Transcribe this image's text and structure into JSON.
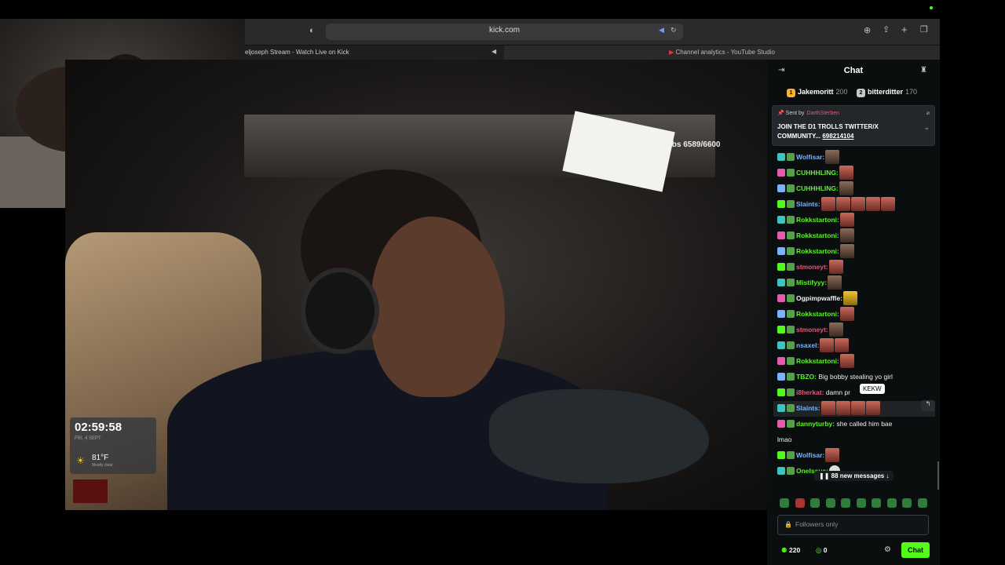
{
  "browser": {
    "url": "kick.com",
    "tab_left": "eljoseph Stream - Watch Live on Kick",
    "tab_right": "Channel analytics - YouTube Studio"
  },
  "video": {
    "subs_goal": "Subs 6589/6600",
    "clock": "02:59:58",
    "clock_sub": "FRI, 4 SEPT",
    "temperature": "81°F",
    "weather_desc": "Mostly clear",
    "icons": [
      "sun-icon"
    ]
  },
  "chat": {
    "title": "Chat",
    "leaderboard": [
      {
        "name": "Jakemoritt",
        "count": "200"
      },
      {
        "name": "bitterditter",
        "count": "170"
      }
    ],
    "pinned": {
      "sent_by": "Sent by",
      "sender": "DarthSterben",
      "text": "JOIN THE D1 TROLLS TWITTER/X COMMUNITY...",
      "link": "698214104"
    },
    "messages": [
      {
        "user": "Wolfisar:",
        "color": "#7bb3ff",
        "text": "",
        "emotes": 1
      },
      {
        "user": "CUHHHLING:",
        "color": "#53fc18",
        "text": "",
        "emotes": 1
      },
      {
        "user": "CUHHHLING:",
        "color": "#53fc18",
        "text": "",
        "emotes": 1
      },
      {
        "user": "Slaints:",
        "color": "#7bb3ff",
        "text": "",
        "emotes": 5
      },
      {
        "user": "Rokkstartoni:",
        "color": "#53fc18",
        "text": "",
        "emotes": 1
      },
      {
        "user": "Rokkstartoni:",
        "color": "#53fc18",
        "text": "",
        "emotes": 1
      },
      {
        "user": "Rokkstartoni:",
        "color": "#53fc18",
        "text": "",
        "emotes": 1
      },
      {
        "user": "stmoneyt:",
        "color": "#e8557a",
        "text": "",
        "emotes": 1
      },
      {
        "user": "Mistifyyy:",
        "color": "#53fc18",
        "text": "",
        "emotes": 1
      },
      {
        "user": "Ogpimpwaffle:",
        "color": "#f0f0f0",
        "text": "",
        "emotes": 1
      },
      {
        "user": "Rokkstartoni:",
        "color": "#53fc18",
        "text": "",
        "emotes": 1
      },
      {
        "user": "stmoneyt:",
        "color": "#e8557a",
        "text": "",
        "emotes": 1
      },
      {
        "user": "nsaxel:",
        "color": "#7bb3ff",
        "text": "",
        "emotes": 2
      },
      {
        "user": "Rokkstartoni:",
        "color": "#53fc18",
        "text": "",
        "emotes": 1
      },
      {
        "user": "TBZO:",
        "color": "#53fc18",
        "text": "Big bobby stealing yo girl",
        "emotes": 0
      },
      {
        "user": "i8herkat:",
        "color": "#e8557a",
        "text": "damn pr",
        "emotes": 0
      },
      {
        "user": "Slaints:",
        "color": "#7bb3ff",
        "text": "",
        "emotes": 4
      },
      {
        "user": "dannyturby:",
        "color": "#53fc18",
        "text": "she called him bae",
        "emotes": 0
      },
      {
        "user": "",
        "color": "#eeeeee",
        "text": "lmao",
        "emotes": 0
      },
      {
        "user": "Wolfisar:",
        "color": "#7bb3ff",
        "text": "",
        "emotes": 1
      },
      {
        "user": "OneIssue:",
        "color": "#53fc18",
        "text": "",
        "emotes": 1
      }
    ],
    "tooltip": "KEKW",
    "new_messages": "88 new messages ↓",
    "input_placeholder": "Followers only",
    "viewers": "220",
    "points": "0",
    "send_label": "Chat",
    "accent": "#53fc18"
  }
}
